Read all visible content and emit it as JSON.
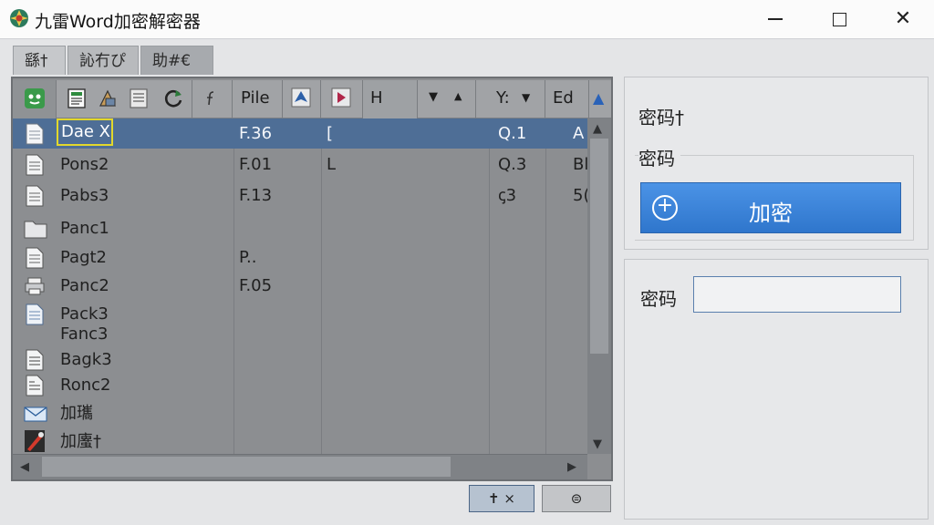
{
  "window": {
    "title": "九雷Word加密解密器"
  },
  "tabs": [
    {
      "label": "繇†"
    },
    {
      "label": "訫冇ぴ"
    },
    {
      "label": "助#€"
    }
  ],
  "toolbar": {
    "icons": [
      "green-app-icon",
      "document-icon",
      "pen-eraser-icon",
      "list-icon",
      "refresh-icon",
      "function-icon",
      "arrow-up-icon",
      "arrow-down-icon"
    ],
    "columns": [
      {
        "label": "Pile"
      },
      {
        "label": "H"
      },
      {
        "label": "Y:"
      },
      {
        "label": "Ed"
      }
    ]
  },
  "files": [
    {
      "name": "Dae X",
      "c2": "F.36",
      "c3": "[",
      "c4": "Q.1",
      "c5": "A",
      "icon": "document-icon",
      "selected": true
    },
    {
      "name": "Pons2",
      "c2": "F.01",
      "c3": "L",
      "c4": "Q.3",
      "c5": "Bl",
      "icon": "document-icon"
    },
    {
      "name": "Pabs3",
      "c2": "F.13",
      "c3": "",
      "c4": "ꞔ3",
      "c5": "5(",
      "icon": "document-icon"
    },
    {
      "name": "Panc1",
      "c2": "",
      "c3": "",
      "c4": "",
      "c5": "",
      "icon": "folder-icon"
    },
    {
      "name": "Pagt2",
      "c2": "P..",
      "c3": "",
      "c4": "",
      "c5": "",
      "icon": "document-icon"
    },
    {
      "name": "Panc2",
      "c2": "F.05",
      "c3": "",
      "c4": "",
      "c5": "",
      "icon": "printer-icon"
    },
    {
      "name": "Pack3",
      "c2": "",
      "c3": "",
      "c4": "",
      "c5": "",
      "icon": "document-icon"
    },
    {
      "name": "Fanc3",
      "c2": "",
      "c3": "",
      "c4": "",
      "c5": "",
      "icon": ""
    },
    {
      "name": "Bagk3",
      "c2": "",
      "c3": "",
      "c4": "",
      "c5": "",
      "icon": "document-icon"
    },
    {
      "name": "Ronc2",
      "c2": "",
      "c3": "",
      "c4": "",
      "c5": "",
      "icon": "document-icon"
    },
    {
      "name": "加瓗",
      "c2": "",
      "c3": "",
      "c4": "",
      "c5": "",
      "icon": "mail-icon"
    },
    {
      "name": "加螷†",
      "c2": "",
      "c3": "",
      "c4": "",
      "c5": "",
      "icon": "red-tool-icon"
    }
  ],
  "right_panel": {
    "box1_label": "密码†",
    "group_label": "密码",
    "encrypt_button": "加密",
    "password_label": "密码",
    "password_value": ""
  },
  "bottom_buttons": [
    {
      "label": "✝ ×"
    },
    {
      "label": "⊜"
    }
  ],
  "colors": {
    "accent": "#2f76cc",
    "selection": "#4e6e96",
    "edit_outline": "#e2d82c"
  }
}
